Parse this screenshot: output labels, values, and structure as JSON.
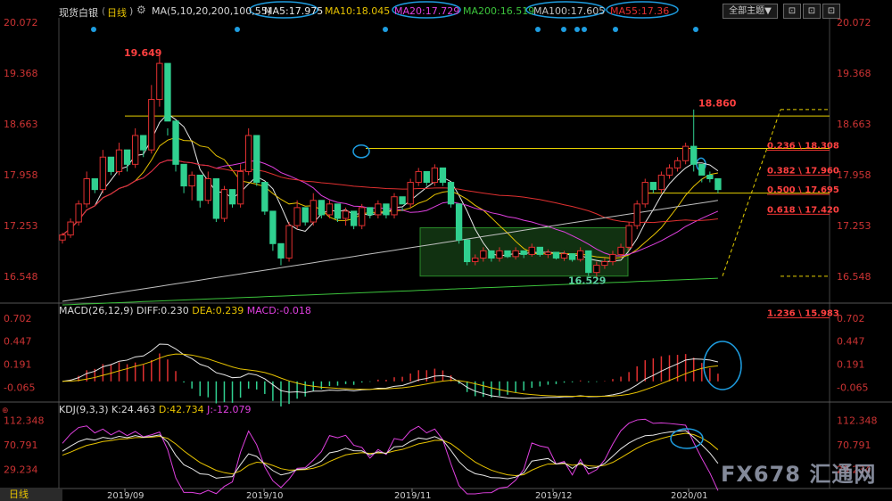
{
  "header": {
    "symbol": "现货白银",
    "period": "日线",
    "ma_prefix": "MA(5,10,20,200,100,55)",
    "ma5": "MA5:17.975",
    "ma10": "MA10:18.045",
    "ma20": "MA20:17.729",
    "ma200": "MA200:16.519",
    "ma100": "MA100:17.605",
    "ma55": "MA55:17.36",
    "theme_select": "全部主题▼",
    "colors": {
      "ma5": "#e8e8e8",
      "ma10": "#e6c200",
      "ma20": "#e040e0",
      "ma200": "#3cc43c",
      "ma100": "#c0c0c0",
      "ma55": "#e03030",
      "up": "#e03030",
      "down": "#30d090",
      "annot": "#1e9de0"
    }
  },
  "buttons": {
    "b1": "⊡",
    "b2": "⊡",
    "b3": "⊡"
  },
  "bottom": {
    "period_label": "日线",
    "watermark": "FX678 汇通网"
  },
  "chart_data": [
    {
      "type": "candlestick",
      "title": "现货白银 日线",
      "y_ticks": [
        "20.072",
        "19.368",
        "18.663",
        "17.958",
        "17.253",
        "16.548"
      ],
      "ylim": [
        16.2,
        20.07
      ],
      "x_labels": [
        "2019/09",
        "2019/10",
        "2019/11",
        "2019/12",
        "2020/01"
      ],
      "annotations": {
        "high_label": "19.649",
        "high_label2": "18.860",
        "low_label": "16.529"
      },
      "fib_levels": [
        {
          "label": "0.236 \\ 18.308",
          "value": 18.308
        },
        {
          "label": "0.382 \\ 17.960",
          "value": 17.96
        },
        {
          "label": "0.500 \\ 17.695",
          "value": 17.695
        },
        {
          "label": "0.618 \\ 17.420",
          "value": 17.42
        },
        {
          "label": "1.236 \\ 15.983",
          "value": 15.983
        }
      ],
      "candles": [
        [
          17.05,
          17.15,
          17.0,
          17.12
        ],
        [
          17.12,
          17.35,
          17.08,
          17.3
        ],
        [
          17.3,
          17.6,
          17.25,
          17.55
        ],
        [
          17.55,
          18.0,
          17.5,
          17.9
        ],
        [
          17.9,
          17.85,
          17.7,
          17.75
        ],
        [
          17.75,
          18.3,
          17.7,
          18.2
        ],
        [
          18.2,
          18.1,
          17.95,
          18.0
        ],
        [
          18.0,
          18.4,
          17.95,
          18.3
        ],
        [
          18.3,
          18.2,
          18.0,
          18.1
        ],
        [
          18.1,
          18.6,
          18.05,
          18.5
        ],
        [
          18.5,
          18.4,
          18.2,
          18.3
        ],
        [
          18.3,
          19.2,
          18.25,
          19.0
        ],
        [
          19.0,
          19.65,
          18.9,
          19.5
        ],
        [
          19.5,
          18.6,
          18.5,
          18.7
        ],
        [
          18.7,
          18.2,
          18.0,
          18.1
        ],
        [
          18.1,
          17.9,
          17.7,
          17.8
        ],
        [
          17.8,
          18.0,
          17.6,
          17.95
        ],
        [
          17.95,
          17.6,
          17.5,
          17.6
        ],
        [
          17.6,
          18.0,
          17.55,
          17.9
        ],
        [
          17.9,
          17.4,
          17.3,
          17.35
        ],
        [
          17.35,
          17.8,
          17.3,
          17.75
        ],
        [
          17.75,
          17.6,
          17.5,
          17.55
        ],
        [
          17.55,
          18.1,
          17.5,
          18.0
        ],
        [
          18.0,
          18.6,
          17.95,
          18.5
        ],
        [
          18.5,
          17.9,
          17.8,
          17.85
        ],
        [
          17.85,
          17.5,
          17.4,
          17.45
        ],
        [
          17.45,
          17.1,
          16.9,
          17.0
        ],
        [
          17.0,
          16.9,
          16.7,
          16.8
        ],
        [
          16.8,
          17.3,
          16.75,
          17.25
        ],
        [
          17.25,
          17.6,
          17.2,
          17.5
        ],
        [
          17.5,
          17.4,
          17.25,
          17.3
        ],
        [
          17.3,
          17.7,
          17.25,
          17.6
        ],
        [
          17.6,
          17.45,
          17.35,
          17.4
        ],
        [
          17.4,
          17.6,
          17.35,
          17.55
        ],
        [
          17.55,
          17.4,
          17.3,
          17.35
        ],
        [
          17.35,
          17.5,
          17.25,
          17.45
        ],
        [
          17.45,
          17.3,
          17.2,
          17.25
        ],
        [
          17.25,
          17.55,
          17.2,
          17.5
        ],
        [
          17.5,
          17.45,
          17.35,
          17.4
        ],
        [
          17.4,
          17.6,
          17.35,
          17.55
        ],
        [
          17.55,
          17.45,
          17.35,
          17.4
        ],
        [
          17.4,
          17.7,
          17.35,
          17.65
        ],
        [
          17.65,
          17.5,
          17.45,
          17.55
        ],
        [
          17.55,
          17.9,
          17.5,
          17.85
        ],
        [
          17.85,
          18.05,
          17.8,
          18.0
        ],
        [
          18.0,
          17.9,
          17.8,
          17.85
        ],
        [
          17.85,
          18.1,
          17.8,
          18.05
        ],
        [
          18.05,
          17.9,
          17.8,
          17.85
        ],
        [
          17.85,
          17.6,
          17.5,
          17.55
        ],
        [
          17.55,
          17.1,
          17.0,
          17.05
        ],
        [
          17.05,
          16.8,
          16.7,
          16.75
        ],
        [
          16.75,
          16.85,
          16.7,
          16.8
        ],
        [
          16.8,
          16.95,
          16.75,
          16.9
        ],
        [
          16.9,
          16.85,
          16.75,
          16.8
        ],
        [
          16.8,
          16.95,
          16.75,
          16.9
        ],
        [
          16.9,
          16.85,
          16.8,
          16.82
        ],
        [
          16.82,
          16.95,
          16.78,
          16.9
        ],
        [
          16.9,
          16.88,
          16.8,
          16.85
        ],
        [
          16.85,
          17.0,
          16.82,
          16.95
        ],
        [
          16.95,
          16.9,
          16.82,
          16.85
        ],
        [
          16.85,
          16.92,
          16.8,
          16.88
        ],
        [
          16.88,
          16.85,
          16.78,
          16.8
        ],
        [
          16.8,
          16.9,
          16.76,
          16.86
        ],
        [
          16.86,
          16.82,
          16.75,
          16.78
        ],
        [
          16.78,
          16.95,
          16.75,
          16.9
        ],
        [
          16.9,
          16.7,
          16.55,
          16.6
        ],
        [
          16.6,
          16.75,
          16.53,
          16.7
        ],
        [
          16.7,
          16.8,
          16.65,
          16.75
        ],
        [
          16.75,
          16.9,
          16.7,
          16.85
        ],
        [
          16.85,
          17.0,
          16.8,
          16.95
        ],
        [
          16.95,
          17.3,
          16.9,
          17.25
        ],
        [
          17.25,
          17.6,
          17.2,
          17.55
        ],
        [
          17.55,
          17.9,
          17.5,
          17.85
        ],
        [
          17.85,
          17.8,
          17.7,
          17.75
        ],
        [
          17.75,
          18.0,
          17.7,
          17.95
        ],
        [
          17.95,
          18.1,
          17.9,
          18.05
        ],
        [
          18.05,
          18.2,
          18.0,
          18.15
        ],
        [
          18.15,
          18.4,
          18.1,
          18.35
        ],
        [
          18.35,
          18.86,
          18.0,
          18.1
        ],
        [
          18.1,
          17.9,
          17.85,
          17.95
        ],
        [
          17.95,
          18.0,
          17.85,
          17.9
        ],
        [
          17.9,
          17.75,
          17.7,
          17.75
        ]
      ]
    },
    {
      "type": "line",
      "title": "MACD(26,12,9)",
      "series": [
        {
          "name": "DIFF",
          "last": "DIFF:0.230"
        },
        {
          "name": "DEA",
          "last": "DEA:0.239"
        },
        {
          "name": "MACD",
          "last": "MACD:-0.018"
        }
      ],
      "y_ticks": [
        "0.702",
        "0.447",
        "0.191",
        "-0.065"
      ],
      "ylim": [
        -0.2,
        0.75
      ]
    },
    {
      "type": "line",
      "title": "KDJ(9,3,3)",
      "series": [
        {
          "name": "K",
          "last": "K:24.463"
        },
        {
          "name": "D",
          "last": "D:42.734"
        },
        {
          "name": "J",
          "last": "J:-12.079"
        }
      ],
      "y_ticks": [
        "112.348",
        "70.791",
        "29.234"
      ],
      "ylim": [
        0,
        125
      ]
    }
  ]
}
